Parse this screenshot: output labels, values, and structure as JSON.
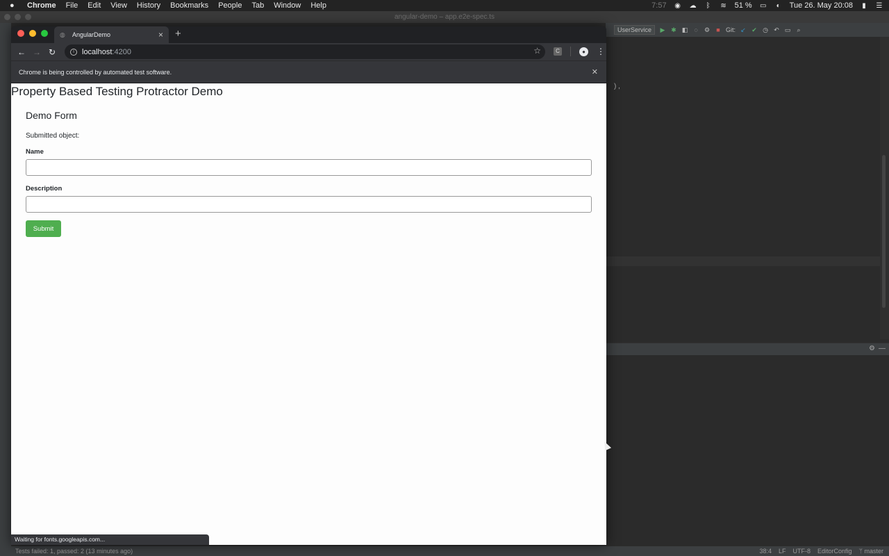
{
  "menubar": {
    "apple_icon": "apple-icon",
    "app": "Chrome",
    "items": [
      "File",
      "Edit",
      "View",
      "History",
      "Bookmarks",
      "People",
      "Tab",
      "Window",
      "Help"
    ],
    "time_left": "7:57",
    "battery": "51 %",
    "datetime": "Tue 26. May  20:08"
  },
  "ide": {
    "window_title": "angular-demo – app.e2e-spec.ts",
    "run_config": "UserService",
    "git_label": "Git:",
    "code_char": ") ,",
    "status_left": "Tests failed: 1, passed: 2 (13 minutes ago)",
    "status_position": "38:4",
    "status_lf": "LF",
    "status_encoding": "UTF-8",
    "status_editorconfig": "EditorConfig",
    "status_branch": "master"
  },
  "chrome": {
    "tab_title": "AngularDemo",
    "url_host": "localhost",
    "url_port": ":4200",
    "ext_letter": "C",
    "infobar_text": "Chrome is being controlled by automated test software.",
    "status_bubble": "Waiting for fonts.googleapis.com..."
  },
  "page": {
    "heading": "Property Based Testing Protractor Demo",
    "form_title": "Demo Form",
    "submitted_label": "Submitted object:",
    "name_label": "Name",
    "name_value": "",
    "description_label": "Description",
    "description_value": "",
    "submit_label": "Submit",
    "submit_color": "#4fae4f"
  }
}
